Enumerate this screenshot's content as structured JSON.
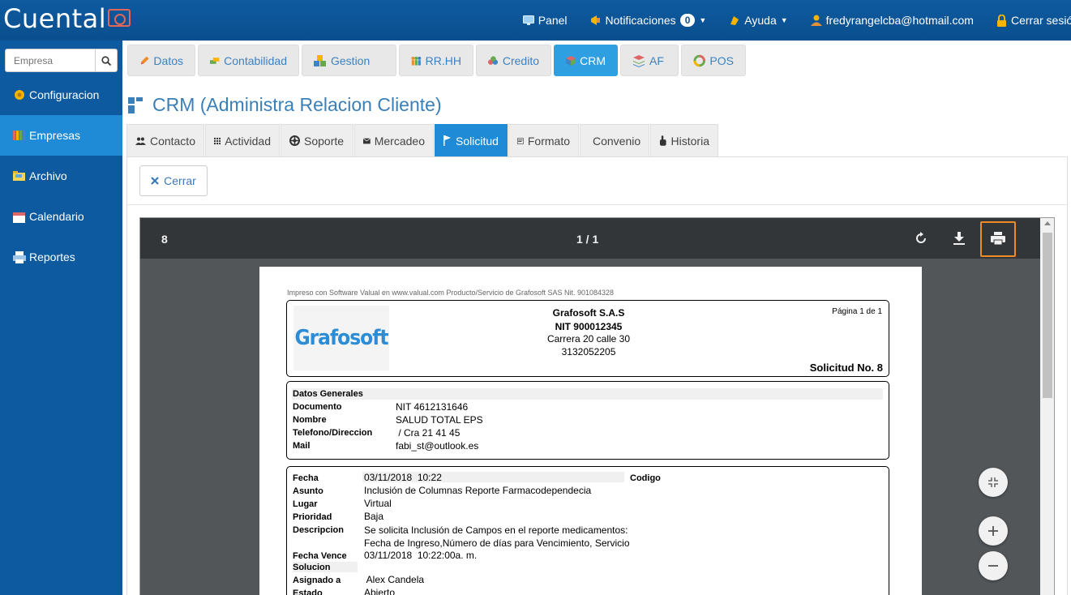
{
  "app": {
    "logo": "Cuental"
  },
  "topnav": {
    "panel": "Panel",
    "notificaciones": "Notificaciones",
    "notif_count": "0",
    "ayuda": "Ayuda",
    "user": "fredyrangelcba@hotmail.com",
    "logout": "Cerrar sesión"
  },
  "sidebar": {
    "search_placeholder": "Empresa",
    "items": [
      {
        "label": "Configuracion",
        "icon": "gear-icon"
      },
      {
        "label": "Empresas",
        "icon": "books-icon"
      },
      {
        "label": "Archivo",
        "icon": "folder-icon"
      },
      {
        "label": "Calendario",
        "icon": "calendar-icon"
      },
      {
        "label": "Reportes",
        "icon": "printer-icon"
      }
    ]
  },
  "modules": [
    {
      "label": "Datos"
    },
    {
      "label": "Contabilidad"
    },
    {
      "label": "Gestion"
    },
    {
      "label": "RR.HH"
    },
    {
      "label": "Credito"
    },
    {
      "label": "CRM"
    },
    {
      "label": "AF"
    },
    {
      "label": "POS"
    }
  ],
  "page": {
    "title": "CRM (Administra Relacion Cliente)"
  },
  "subtabs": [
    {
      "label": "Contacto"
    },
    {
      "label": "Actividad"
    },
    {
      "label": "Soporte"
    },
    {
      "label": "Mercadeo"
    },
    {
      "label": "Solicitud"
    },
    {
      "label": "Formato"
    },
    {
      "label": "Convenio"
    },
    {
      "label": "Historia"
    }
  ],
  "actions": {
    "close": "Cerrar"
  },
  "viewer": {
    "doc_number": "8",
    "pages": "1 / 1"
  },
  "pdf": {
    "printed_by": "Impreso con Software Valual en www.valual.com Producto/Servicio de Grafosoft SAS Nit. 901084328",
    "logo_text": "Grafosoft",
    "company": "Grafosoft S.A.S",
    "nit": "NIT 900012345",
    "address": "Carrera 20 calle 30",
    "phone": "3132052205",
    "page_of": "Página 1 de 1",
    "solicitud": "Solicitud No. 8",
    "general_title": "Datos Generales",
    "general": [
      {
        "label": "Documento",
        "value": "NIT 4612131646"
      },
      {
        "label": "Nombre",
        "value": "SALUD TOTAL EPS"
      },
      {
        "label": "Telefono/Direccion",
        "value": " / Cra 21 41 45"
      },
      {
        "label": "Mail",
        "value": "fabi_st@outlook.es"
      }
    ],
    "detail": {
      "fecha_label": "Fecha",
      "fecha": "03/11/2018  10:22",
      "codigo_label": "Codigo",
      "asunto_label": "Asunto",
      "asunto": "Inclusión de Columnas Reporte Farmacodependecia",
      "lugar_label": "Lugar",
      "lugar": "Virtual",
      "prioridad_label": "Prioridad",
      "prioridad": "Baja",
      "descripcion_label": "Descripcion",
      "descripcion_1": "Se solicita Inclusión de Campos en el reporte medicamentos:",
      "descripcion_2": "Fecha de Ingreso,Número de días para Vencimiento, Servicio",
      "vence_label": "Fecha Vence",
      "vence": "03/11/2018  10:22:00a. m.",
      "solucion_label": "Solucion",
      "asignado_label": "Asignado a",
      "asignado": " Alex Candela",
      "estado_label": "Estado",
      "estado": "Abierto"
    }
  }
}
